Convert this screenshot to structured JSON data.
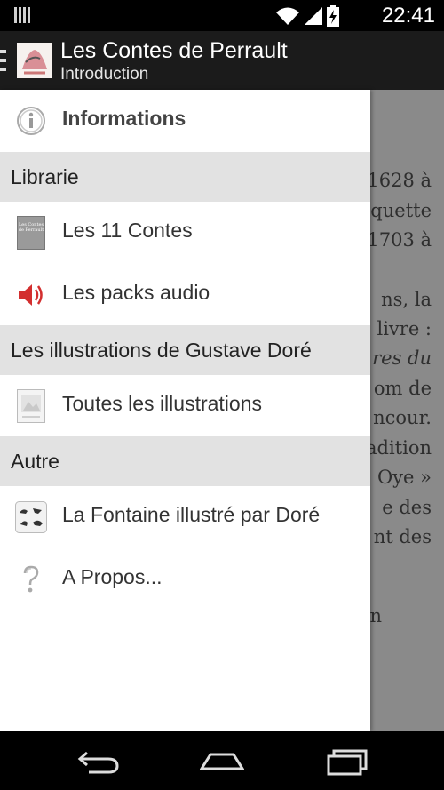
{
  "status_bar": {
    "time": "22:41",
    "icons": [
      "notification-icon",
      "wifi-icon",
      "signal-icon",
      "battery-charging-icon"
    ]
  },
  "action_bar": {
    "title": "Les Contes de Perrault",
    "subtitle": "Introduction"
  },
  "drawer": {
    "header_item": {
      "label": "Informations",
      "icon": "info-icon"
    },
    "sections": [
      {
        "title": "Librarie",
        "items": [
          {
            "label": "Les 11 Contes",
            "icon": "book-cover-icon",
            "cover_text": "Les Contes de Perrault"
          },
          {
            "label": "Les packs audio",
            "icon": "speaker-icon"
          }
        ]
      },
      {
        "title": "Les illustrations de Gustave Doré",
        "items": [
          {
            "label": "Toutes les illustrations",
            "icon": "illustration-icon"
          }
        ]
      },
      {
        "title": "Autre",
        "items": [
          {
            "label": "La Fontaine illustré par Doré",
            "icon": "animals-icon"
          },
          {
            "label": "A Propos...",
            "icon": "question-icon"
          }
        ]
      }
    ]
  },
  "background_text": [
    "1628 à",
    "quette",
    "1703 à",
    "ns, la",
    "livre :",
    "res du",
    "om de",
    "ncour.",
    "adition",
    "Oye »",
    "e des",
    "nt des",
    "n"
  ],
  "colors": {
    "action_bar": "#1b1b1b",
    "section_bg": "#e2e2e2",
    "speaker": "#d32f2f",
    "overlay": "#8a8a8a"
  }
}
